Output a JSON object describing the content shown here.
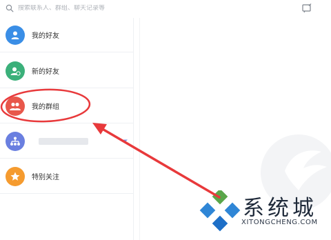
{
  "search": {
    "placeholder": "搜索联系人、群组、聊天记录等"
  },
  "contacts": {
    "items": [
      {
        "label": "我的好友",
        "icon": "person-icon",
        "color": "#3a8ee6"
      },
      {
        "label": "新的好友",
        "icon": "add-person-icon",
        "color": "#3bb07a"
      },
      {
        "label": "我的群组",
        "icon": "group-icon",
        "color": "#e8574b"
      },
      {
        "label": "",
        "icon": "org-tree-icon",
        "color": "#6a7fe0"
      },
      {
        "label": "特别关注",
        "icon": "star-icon",
        "color": "#f59b2f"
      }
    ]
  },
  "watermark": {
    "brand_cn": "系统城",
    "brand_en": "XITONGCHENG.COM"
  },
  "colors": {
    "annotation": "#e8393b",
    "divider": "#eef0f3"
  }
}
